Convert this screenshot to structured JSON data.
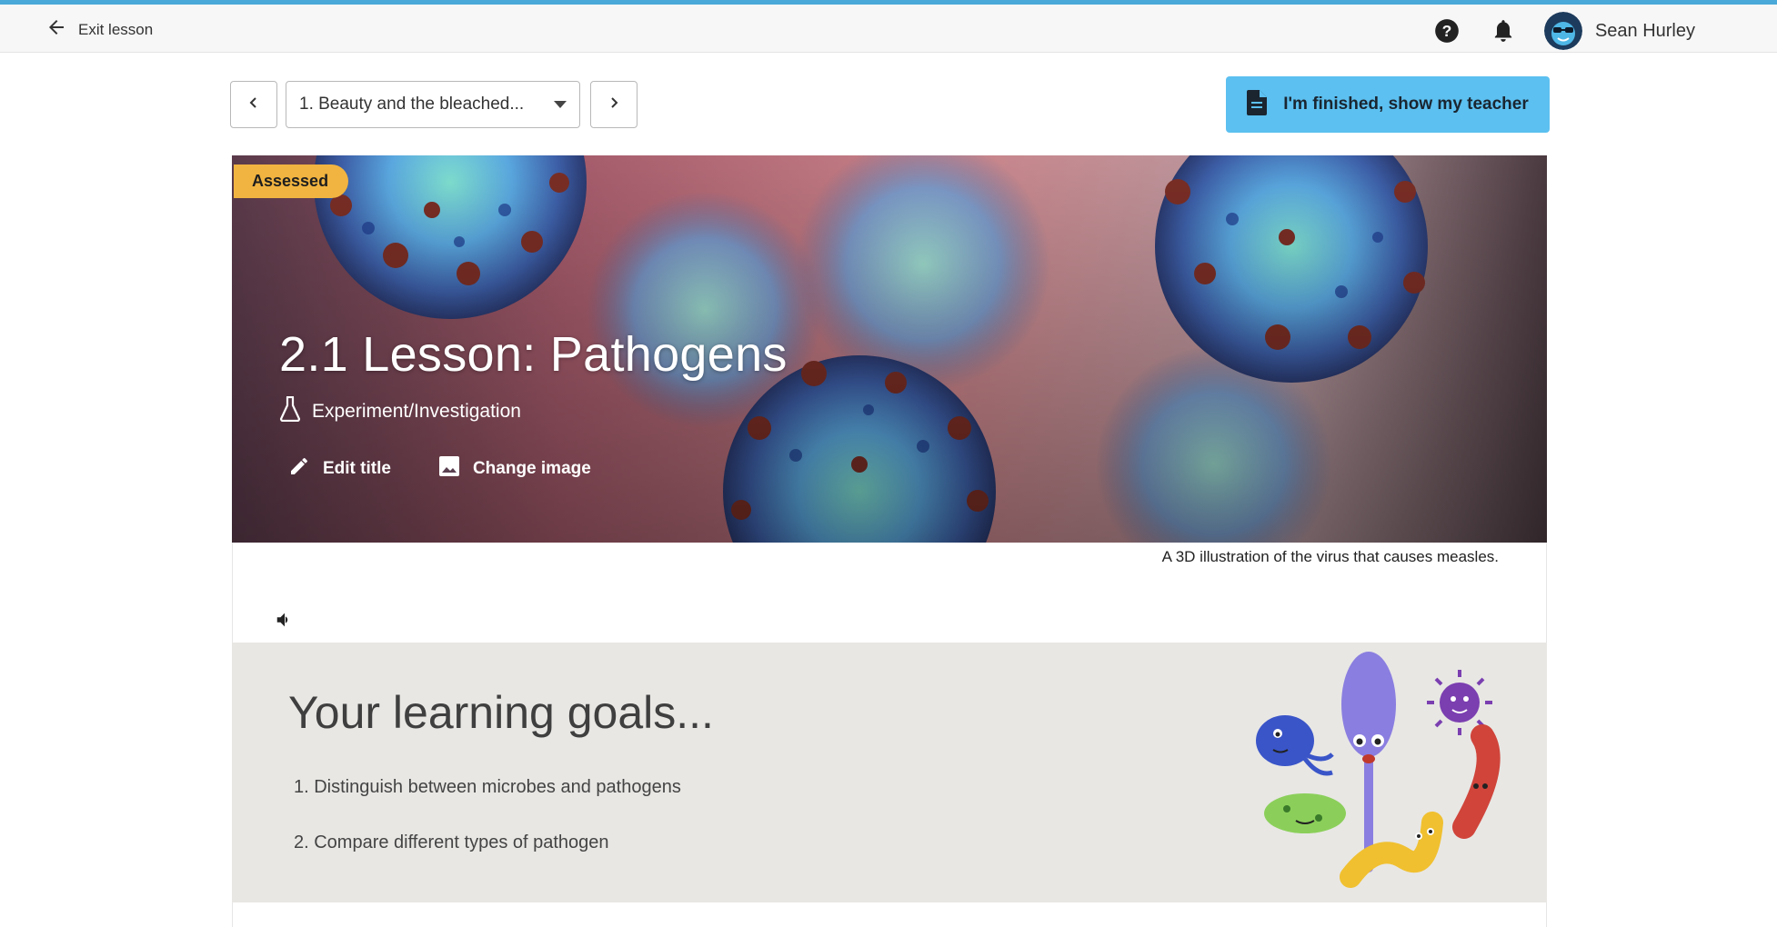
{
  "topbar": {
    "exit_label": "Exit lesson",
    "user_name": "Sean Hurley",
    "icons": [
      "arrow-left-icon",
      "help-icon",
      "bell-icon",
      "avatar"
    ]
  },
  "lesson_nav": {
    "current_lesson": "1. Beauty and the bleached...",
    "finished_label": "I'm finished, show my teacher"
  },
  "hero": {
    "badge": "Assessed",
    "title": "2.1 Lesson: Pathogens",
    "type_label": "Experiment/Investigation",
    "edit_title_label": "Edit title",
    "change_image_label": "Change image",
    "caption": "A 3D illustration of the virus that causes measles."
  },
  "goals": {
    "title": "Your learning goals...",
    "items": [
      "1. Distinguish between microbes and pathogens",
      "2. Compare different types of pathogen"
    ]
  },
  "colors": {
    "accent": "#4aa9d8",
    "finished_button": "#5cc0f0",
    "badge": "#f1b440",
    "goals_bg": "#e8e7e4"
  }
}
